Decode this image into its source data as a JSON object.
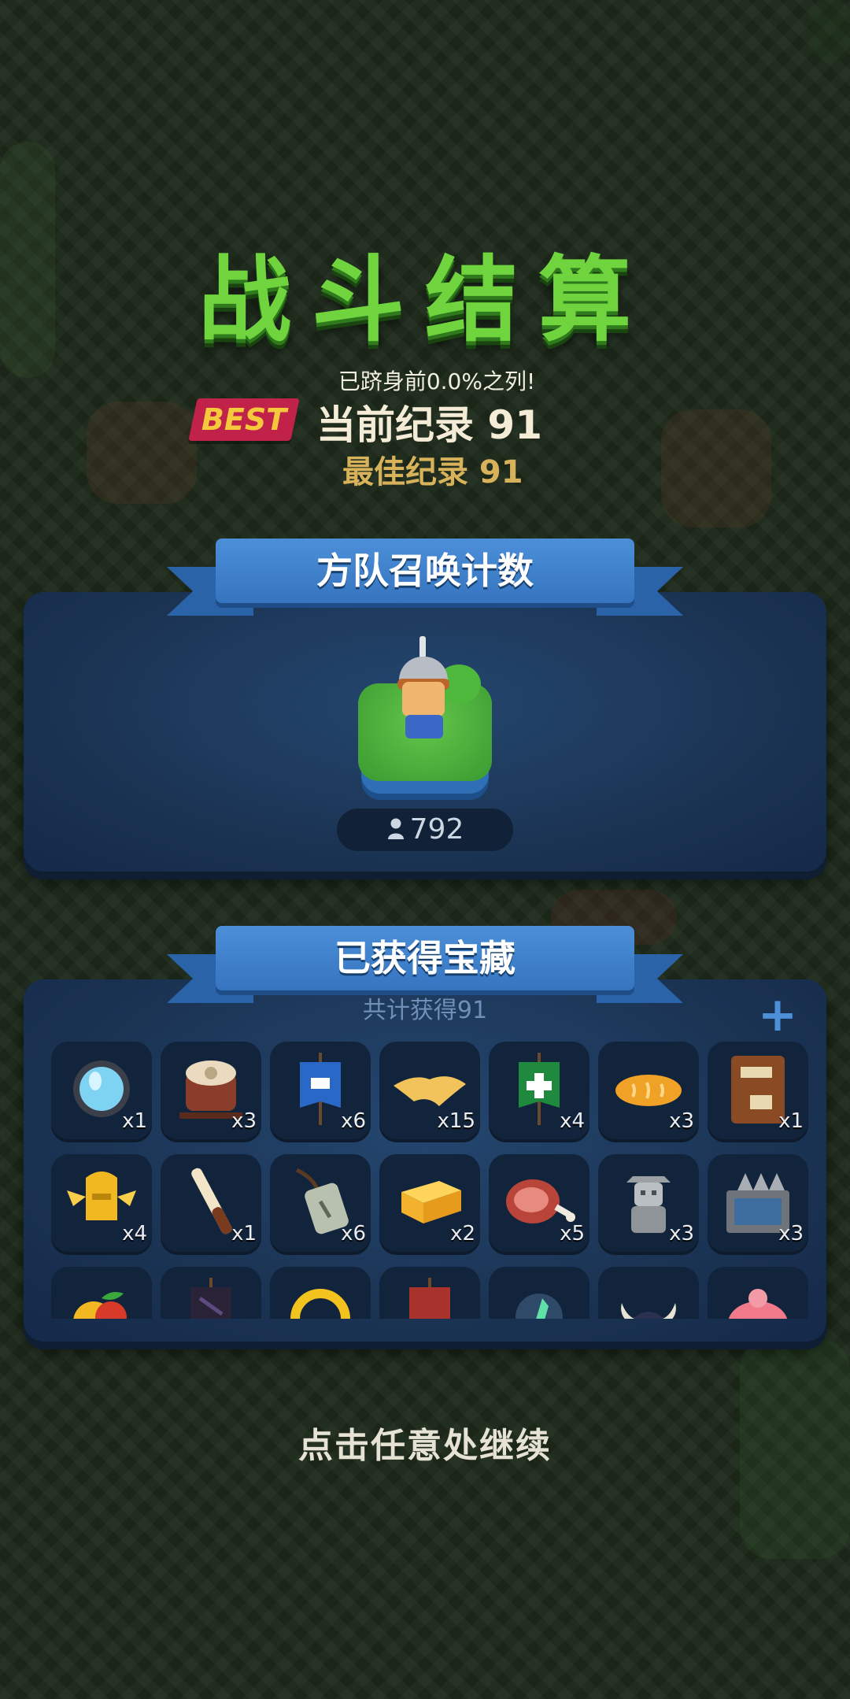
{
  "header": {
    "title": "战斗结算",
    "rank_note": "已跻身前0.0%之列!",
    "best_badge": "BEST",
    "current_record": "当前纪录 91",
    "best_record": "最佳纪录 91"
  },
  "squad": {
    "title": "方队召唤计数",
    "count": "792",
    "count_icon": "person-icon",
    "unit_icon": "spearman-icon"
  },
  "treasure": {
    "title": "已获得宝藏",
    "total": "共计获得91",
    "add_icon": "plus-icon",
    "items": [
      {
        "icon": "mirror-icon",
        "qty": "x1"
      },
      {
        "icon": "war-drum-icon",
        "qty": "x3"
      },
      {
        "icon": "blue-banner-icon",
        "qty": "x6"
      },
      {
        "icon": "cloth-icon",
        "qty": "x15"
      },
      {
        "icon": "green-cross-banner-icon",
        "qty": "x4"
      },
      {
        "icon": "bread-icon",
        "qty": "x3"
      },
      {
        "icon": "book-icon",
        "qty": "x1"
      },
      {
        "icon": "golden-winged-helmet-icon",
        "qty": "x4"
      },
      {
        "icon": "flute-icon",
        "qty": "x1"
      },
      {
        "icon": "tag-pendant-icon",
        "qty": "x6"
      },
      {
        "icon": "cheese-icon",
        "qty": "x2"
      },
      {
        "icon": "ham-icon",
        "qty": "x5"
      },
      {
        "icon": "stone-statue-icon",
        "qty": "x3"
      },
      {
        "icon": "iron-chest-icon",
        "qty": "x3"
      },
      {
        "icon": "fruit-icon",
        "qty": ""
      },
      {
        "icon": "dark-banner-icon",
        "qty": ""
      },
      {
        "icon": "gold-ring-icon",
        "qty": ""
      },
      {
        "icon": "red-banner-icon",
        "qty": ""
      },
      {
        "icon": "green-crystal-icon",
        "qty": ""
      },
      {
        "icon": "horned-helmet-icon",
        "qty": ""
      },
      {
        "icon": "piggy-icon",
        "qty": ""
      }
    ]
  },
  "footer": {
    "continue": "点击任意处继续"
  },
  "colors": {
    "title_green": "#6fd43e",
    "best_red": "#c1224a",
    "best_gold": "#f6c93c",
    "panel_blue": "#1b3454",
    "ribbon_blue": "#3674c0"
  }
}
